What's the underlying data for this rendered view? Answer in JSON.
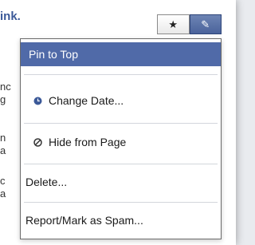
{
  "snippet": "ink.",
  "background_lines": [
    "nc",
    "g",
    "n",
    "a",
    "c",
    "a"
  ],
  "buttons": [
    {
      "name": "star-button",
      "glyph": "★"
    },
    {
      "name": "edit-button",
      "glyph": "✎"
    }
  ],
  "menu": {
    "items": [
      {
        "label": "Pin to Top",
        "icon": ""
      },
      {
        "label": "Change Date...",
        "icon": "clock-icon"
      },
      {
        "label": "Hide from Page",
        "icon": "no-symbol-icon"
      },
      {
        "label": "Delete...",
        "icon": ""
      },
      {
        "label": "Report/Mark as Spam...",
        "icon": ""
      }
    ],
    "highlighted_index": 0,
    "highlight_color": "#506aa8"
  }
}
